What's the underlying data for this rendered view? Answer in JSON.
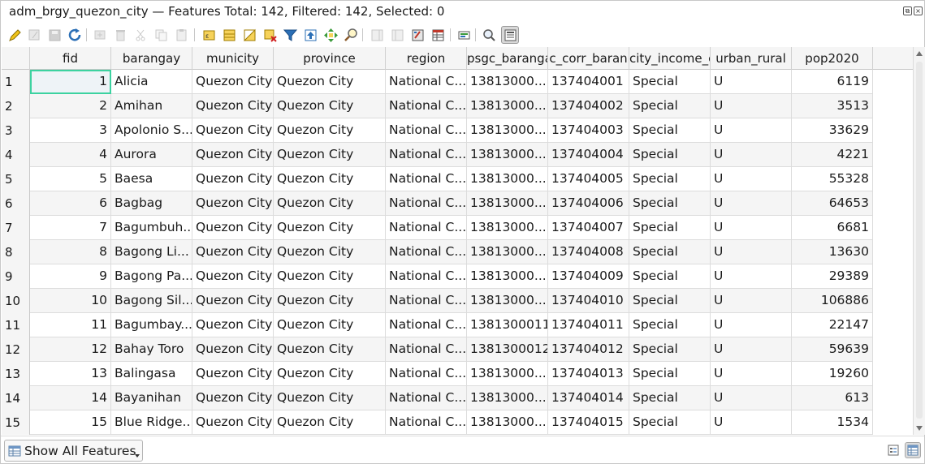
{
  "window": {
    "title": "adm_brgy_quezon_city — Features Total: 142, Filtered: 142, Selected: 0"
  },
  "toolbar": {
    "buttons": [
      {
        "name": "toggle-editing-icon",
        "enabled": true
      },
      {
        "name": "toggle-multi-edit-icon",
        "enabled": false
      },
      {
        "name": "save-edits-icon",
        "enabled": false
      },
      {
        "name": "reload-table-icon",
        "enabled": true
      },
      {
        "name": "add-feature-icon",
        "enabled": false
      },
      {
        "name": "delete-selected-icon",
        "enabled": false
      },
      {
        "name": "cut-icon",
        "enabled": false
      },
      {
        "name": "copy-icon",
        "enabled": false
      },
      {
        "name": "paste-icon",
        "enabled": false
      },
      {
        "name": "select-by-expression-icon",
        "enabled": true
      },
      {
        "name": "select-all-icon",
        "enabled": true
      },
      {
        "name": "invert-selection-icon",
        "enabled": true
      },
      {
        "name": "deselect-all-icon",
        "enabled": true
      },
      {
        "name": "filter-select-icon",
        "enabled": true
      },
      {
        "name": "move-selection-top-icon",
        "enabled": true
      },
      {
        "name": "pan-to-selected-icon",
        "enabled": true
      },
      {
        "name": "zoom-to-selected-icon",
        "enabled": true
      },
      {
        "name": "new-field-icon",
        "enabled": false
      },
      {
        "name": "delete-field-icon",
        "enabled": false
      },
      {
        "name": "field-calculator-icon",
        "enabled": true
      },
      {
        "name": "conditional-formatting-icon",
        "enabled": true
      },
      {
        "name": "actions-icon",
        "enabled": true
      },
      {
        "name": "dock-icon",
        "enabled": true
      },
      {
        "name": "organize-columns-icon",
        "enabled": true
      }
    ]
  },
  "table": {
    "columns": [
      "fid",
      "barangay",
      "municity",
      "province",
      "region",
      "psgc_baranga",
      "c_corr_baran",
      "city_income_c",
      "urban_rural",
      "pop2020"
    ],
    "rows": [
      {
        "rh": "1",
        "fid": "1",
        "barangay": "Alicia",
        "municity": "Quezon City",
        "province": "Quezon City",
        "region": "National C...",
        "psgc": "13813000...",
        "corr": "137404001",
        "income": "Special",
        "ur": "U",
        "pop": "6119"
      },
      {
        "rh": "2",
        "fid": "2",
        "barangay": "Amihan",
        "municity": "Quezon City",
        "province": "Quezon City",
        "region": "National C...",
        "psgc": "13813000...",
        "corr": "137404002",
        "income": "Special",
        "ur": "U",
        "pop": "3513"
      },
      {
        "rh": "3",
        "fid": "3",
        "barangay": "Apolonio S...",
        "municity": "Quezon City",
        "province": "Quezon City",
        "region": "National C...",
        "psgc": "13813000...",
        "corr": "137404003",
        "income": "Special",
        "ur": "U",
        "pop": "33629"
      },
      {
        "rh": "4",
        "fid": "4",
        "barangay": "Aurora",
        "municity": "Quezon City",
        "province": "Quezon City",
        "region": "National C...",
        "psgc": "13813000...",
        "corr": "137404004",
        "income": "Special",
        "ur": "U",
        "pop": "4221"
      },
      {
        "rh": "5",
        "fid": "5",
        "barangay": "Baesa",
        "municity": "Quezon City",
        "province": "Quezon City",
        "region": "National C...",
        "psgc": "13813000...",
        "corr": "137404005",
        "income": "Special",
        "ur": "U",
        "pop": "55328"
      },
      {
        "rh": "6",
        "fid": "6",
        "barangay": "Bagbag",
        "municity": "Quezon City",
        "province": "Quezon City",
        "region": "National C...",
        "psgc": "13813000...",
        "corr": "137404006",
        "income": "Special",
        "ur": "U",
        "pop": "64653"
      },
      {
        "rh": "7",
        "fid": "7",
        "barangay": "Bagumbuh...",
        "municity": "Quezon City",
        "province": "Quezon City",
        "region": "National C...",
        "psgc": "13813000...",
        "corr": "137404007",
        "income": "Special",
        "ur": "U",
        "pop": "6681"
      },
      {
        "rh": "8",
        "fid": "8",
        "barangay": "Bagong Li...",
        "municity": "Quezon City",
        "province": "Quezon City",
        "region": "National C...",
        "psgc": "13813000...",
        "corr": "137404008",
        "income": "Special",
        "ur": "U",
        "pop": "13630"
      },
      {
        "rh": "9",
        "fid": "9",
        "barangay": "Bagong Pa...",
        "municity": "Quezon City",
        "province": "Quezon City",
        "region": "National C...",
        "psgc": "13813000...",
        "corr": "137404009",
        "income": "Special",
        "ur": "U",
        "pop": "29389"
      },
      {
        "rh": "10",
        "fid": "10",
        "barangay": "Bagong Sil...",
        "municity": "Quezon City",
        "province": "Quezon City",
        "region": "National C...",
        "psgc": "13813000...",
        "corr": "137404010",
        "income": "Special",
        "ur": "U",
        "pop": "106886"
      },
      {
        "rh": "11",
        "fid": "11",
        "barangay": "Bagumbay...",
        "municity": "Quezon City",
        "province": "Quezon City",
        "region": "National C...",
        "psgc": "1381300011",
        "corr": "137404011",
        "income": "Special",
        "ur": "U",
        "pop": "22147"
      },
      {
        "rh": "12",
        "fid": "12",
        "barangay": "Bahay Toro",
        "municity": "Quezon City",
        "province": "Quezon City",
        "region": "National C...",
        "psgc": "1381300012",
        "corr": "137404012",
        "income": "Special",
        "ur": "U",
        "pop": "59639"
      },
      {
        "rh": "13",
        "fid": "13",
        "barangay": "Balingasa",
        "municity": "Quezon City",
        "province": "Quezon City",
        "region": "National C...",
        "psgc": "13813000...",
        "corr": "137404013",
        "income": "Special",
        "ur": "U",
        "pop": "19260"
      },
      {
        "rh": "14",
        "fid": "14",
        "barangay": "Bayanihan",
        "municity": "Quezon City",
        "province": "Quezon City",
        "region": "National C...",
        "psgc": "13813000...",
        "corr": "137404014",
        "income": "Special",
        "ur": "U",
        "pop": "613"
      },
      {
        "rh": "15",
        "fid": "15",
        "barangay": "Blue Ridge...",
        "municity": "Quezon City",
        "province": "Quezon City",
        "region": "National C...",
        "psgc": "13813000...",
        "corr": "137404015",
        "income": "Special",
        "ur": "U",
        "pop": "1534"
      }
    ]
  },
  "footer": {
    "filter_label": "Show All Features"
  },
  "colors": {
    "selection_outline": "#3cd2a0",
    "alt_row": "#f5f5f5"
  }
}
